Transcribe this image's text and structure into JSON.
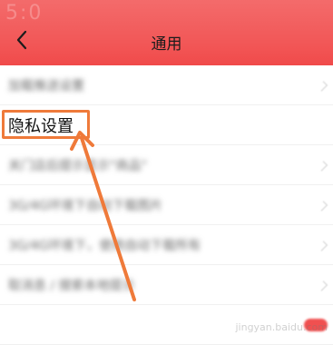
{
  "header": {
    "title": "通用",
    "status_glyphs": "5:0"
  },
  "list": {
    "items": [
      {
        "label": "加载推送设置",
        "blurred": true
      },
      {
        "label": "隐私设置",
        "blurred": false
      },
      {
        "label": "关门店后提示显示\"商品\"",
        "blurred": true
      },
      {
        "label": "3G/4G环境下自动下载图片",
        "blurred": true
      },
      {
        "label": "3G/4G环境下，使用自动下载所有",
        "blurred": true
      },
      {
        "label": "取消息 / 搜索本地提示",
        "blurred": true
      },
      {
        "label": "",
        "blurred": true
      }
    ]
  },
  "annotation": {
    "box_color": "#ef7a3a",
    "arrow_color": "#ef7a3a"
  },
  "watermark": "jingyan.baidu.com",
  "colors": {
    "header_red": "#f25656",
    "accent": "#f05050"
  },
  "icons": {
    "back": "chevron-left-icon"
  }
}
